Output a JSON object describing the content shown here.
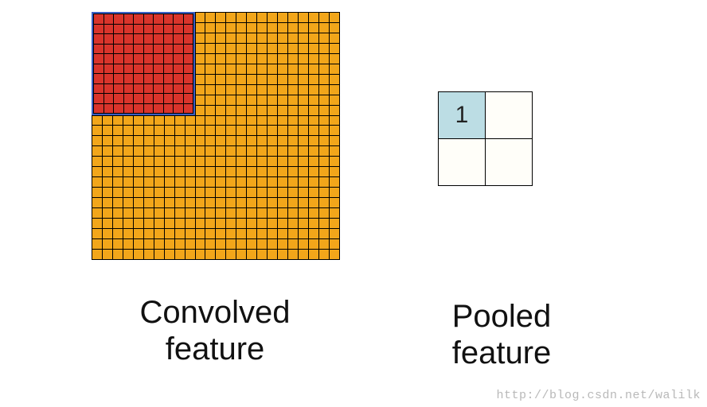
{
  "diagram": {
    "convolved": {
      "grid_size": 24,
      "pool_window": {
        "rows": 10,
        "cols": 10,
        "row": 0,
        "col": 0
      },
      "label_line1": "Convolved",
      "label_line2": "feature"
    },
    "pooled": {
      "rows": 2,
      "cols": 2,
      "active_value": "1",
      "active_row": 0,
      "active_col": 0,
      "label_line1": "Pooled",
      "label_line2": "feature"
    },
    "watermark": "http://blog.csdn.net/walilk"
  }
}
